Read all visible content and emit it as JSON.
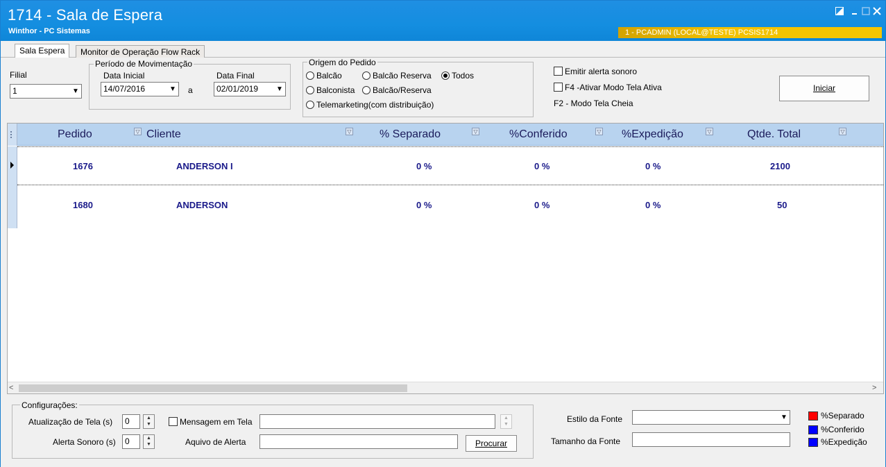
{
  "window": {
    "title": "1714 - Sala de Espera",
    "subtitle": "Winthor - PC Sistemas",
    "user_info": "1 - PCADMIN (LOCAL@TESTE)  PCSIS1714"
  },
  "tabs": [
    {
      "label": "Sala Espera"
    },
    {
      "label": "Monitor de Operação Flow Rack"
    }
  ],
  "filters": {
    "filial_label": "Filial",
    "filial_value": "1",
    "periodo_title": "Período de Movimentação",
    "data_inicial_label": "Data Inicial",
    "data_inicial_value": "14/07/2016",
    "separator": "a",
    "data_final_label": "Data Final",
    "data_final_value": "02/01/2019",
    "origem_title": "Origem do Pedido",
    "origem_options": [
      {
        "label": "Balcão"
      },
      {
        "label": "Balcão Reserva"
      },
      {
        "label": "Todos"
      },
      {
        "label": "Balconista"
      },
      {
        "label": "Balcão/Reserva"
      },
      {
        "label": "Telemarketing(com distribuição)"
      }
    ],
    "origem_selected": "Todos",
    "emitir_alerta": "Emitir alerta sonoro",
    "f4_label": "F4 -Ativar Modo Tela Ativa",
    "f2_label": "F2 - Modo Tela Cheia",
    "iniciar_label": "Iniciar"
  },
  "grid": {
    "columns": [
      "Pedido",
      "Cliente",
      "% Separado",
      "%Conferido",
      "%Expedição",
      "Qtde. Total"
    ],
    "rows": [
      {
        "pedido": "1676",
        "cliente": "ANDERSON I",
        "separado": "0 %",
        "conferido": "0 %",
        "expedicao": "0 %",
        "qtde": "2100"
      },
      {
        "pedido": "1680",
        "cliente": "ANDERSON",
        "separado": "0 %",
        "conferido": "0 %",
        "expedicao": "0 %",
        "qtde": "50"
      }
    ]
  },
  "config": {
    "title": "Configurações:",
    "atualizacao_label": "Atualização de Tela (s)",
    "atualizacao_value": "0",
    "alerta_label": "Alerta Sonoro (s)",
    "alerta_value": "0",
    "mensagem_label": "Mensagem em Tela",
    "mensagem_value": "",
    "arquivo_label": "Aquivo de Alerta",
    "arquivo_value": "",
    "procurar_label": "Procurar",
    "estilo_label": "Estilo da Fonte",
    "estilo_value": "",
    "tamanho_label": "Tamanho da Fonte",
    "tamanho_value": ""
  },
  "legend": [
    {
      "label": "%Separado",
      "color": "#ff0000"
    },
    {
      "label": "%Conferido",
      "color": "#0000ff"
    },
    {
      "label": "%Expedição",
      "color": "#0000ff"
    }
  ]
}
